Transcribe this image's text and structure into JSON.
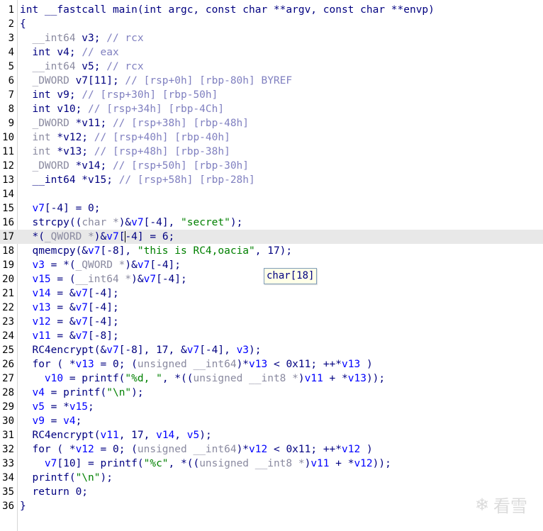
{
  "editor": {
    "current_line": 17,
    "lines": [
      {
        "n": "1",
        "parts": [
          [
            "kw",
            "int __fastcall main(int argc, const char **argv, const char **envp)"
          ]
        ]
      },
      {
        "n": "2",
        "parts": [
          [
            "kw",
            "{"
          ]
        ]
      },
      {
        "n": "3",
        "parts": [
          [
            "gr",
            "  __int64"
          ],
          [
            "kw",
            " v3; "
          ],
          [
            "cm",
            "// rcx"
          ]
        ]
      },
      {
        "n": "4",
        "parts": [
          [
            "kw",
            "  int v4; "
          ],
          [
            "cm",
            "// eax"
          ]
        ]
      },
      {
        "n": "5",
        "parts": [
          [
            "gr",
            "  __int64"
          ],
          [
            "kw",
            " v5; "
          ],
          [
            "cm",
            "// rcx"
          ]
        ]
      },
      {
        "n": "6",
        "parts": [
          [
            "gr",
            "  _DWORD"
          ],
          [
            "kw",
            " v7[11]; "
          ],
          [
            "cm",
            "// [rsp+0h] [rbp-80h] BYREF"
          ]
        ]
      },
      {
        "n": "7",
        "parts": [
          [
            "kw",
            "  int v9; "
          ],
          [
            "cm",
            "// [rsp+30h] [rbp-50h]"
          ]
        ]
      },
      {
        "n": "8",
        "parts": [
          [
            "kw",
            "  int v10; "
          ],
          [
            "cm",
            "// [rsp+34h] [rbp-4Ch]"
          ]
        ]
      },
      {
        "n": "9",
        "parts": [
          [
            "gr",
            "  _DWORD"
          ],
          [
            "kw",
            " *v11; "
          ],
          [
            "cm",
            "// [rsp+38h] [rbp-48h]"
          ]
        ]
      },
      {
        "n": "10",
        "parts": [
          [
            "gr",
            "  int"
          ],
          [
            "kw",
            " *v12; "
          ],
          [
            "cm",
            "// [rsp+40h] [rbp-40h]"
          ]
        ]
      },
      {
        "n": "11",
        "parts": [
          [
            "gr",
            "  int"
          ],
          [
            "kw",
            " *v13; "
          ],
          [
            "cm",
            "// [rsp+48h] [rbp-38h]"
          ]
        ]
      },
      {
        "n": "12",
        "parts": [
          [
            "gr",
            "  _DWORD"
          ],
          [
            "kw",
            " *v14; "
          ],
          [
            "cm",
            "// [rsp+50h] [rbp-30h]"
          ]
        ]
      },
      {
        "n": "13",
        "parts": [
          [
            "kw",
            "  __int64 *v15; "
          ],
          [
            "cm",
            "// [rsp+58h] [rbp-28h]"
          ]
        ]
      },
      {
        "n": "14",
        "parts": [
          [
            "kw",
            ""
          ]
        ]
      },
      {
        "n": "15",
        "parts": [
          [
            "vr",
            "  v7"
          ],
          [
            "kw",
            "[-4] = 0;"
          ]
        ]
      },
      {
        "n": "16",
        "parts": [
          [
            "kw",
            "  strcpy(("
          ],
          [
            "gr",
            "char *"
          ],
          [
            "kw",
            ")&"
          ],
          [
            "vr",
            "v7"
          ],
          [
            "kw",
            "[-4], "
          ],
          [
            "str",
            "\"secret\""
          ],
          [
            "kw",
            ");"
          ]
        ]
      },
      {
        "n": "17",
        "parts": [
          [
            "kw",
            "  *("
          ],
          [
            "gr",
            "_QWORD *"
          ],
          [
            "kw",
            ")&"
          ],
          [
            "vr",
            "v7"
          ],
          [
            "kw",
            "["
          ],
          [
            "cursor",
            ""
          ],
          [
            "kw",
            "-4] = 6;"
          ]
        ]
      },
      {
        "n": "18",
        "parts": [
          [
            "kw",
            "  qmemcpy(&"
          ],
          [
            "vr",
            "v7"
          ],
          [
            "kw",
            "[-8], "
          ],
          [
            "str",
            "\"this is RC4,oacia\""
          ],
          [
            "kw",
            ", 17);"
          ]
        ]
      },
      {
        "n": "19",
        "parts": [
          [
            "vr",
            "  v3"
          ],
          [
            "kw",
            " = *("
          ],
          [
            "gr",
            "_QWORD *"
          ],
          [
            "kw",
            ")&"
          ],
          [
            "vr",
            "v7"
          ],
          [
            "kw",
            "[-4];"
          ]
        ]
      },
      {
        "n": "20",
        "parts": [
          [
            "vr",
            "  v15"
          ],
          [
            "kw",
            " = ("
          ],
          [
            "gr",
            "__int64 *"
          ],
          [
            "kw",
            ")&"
          ],
          [
            "vr",
            "v7"
          ],
          [
            "kw",
            "[-4];"
          ]
        ]
      },
      {
        "n": "21",
        "parts": [
          [
            "vr",
            "  v14"
          ],
          [
            "kw",
            " = &"
          ],
          [
            "vr",
            "v7"
          ],
          [
            "kw",
            "[-4];"
          ]
        ]
      },
      {
        "n": "22",
        "parts": [
          [
            "vr",
            "  v13"
          ],
          [
            "kw",
            " = &"
          ],
          [
            "vr",
            "v7"
          ],
          [
            "kw",
            "[-4];"
          ]
        ]
      },
      {
        "n": "23",
        "parts": [
          [
            "vr",
            "  v12"
          ],
          [
            "kw",
            " = &"
          ],
          [
            "vr",
            "v7"
          ],
          [
            "kw",
            "[-4];"
          ]
        ]
      },
      {
        "n": "24",
        "parts": [
          [
            "vr",
            "  v11"
          ],
          [
            "kw",
            " = &"
          ],
          [
            "vr",
            "v7"
          ],
          [
            "kw",
            "[-8];"
          ]
        ]
      },
      {
        "n": "25",
        "parts": [
          [
            "kw",
            "  RC4encrypt(&"
          ],
          [
            "vr",
            "v7"
          ],
          [
            "kw",
            "[-8], 17, &"
          ],
          [
            "vr",
            "v7"
          ],
          [
            "kw",
            "[-4], "
          ],
          [
            "vr",
            "v3"
          ],
          [
            "kw",
            ");"
          ]
        ]
      },
      {
        "n": "26",
        "parts": [
          [
            "kw",
            "  for ( *"
          ],
          [
            "vr",
            "v13"
          ],
          [
            "kw",
            " = 0; ("
          ],
          [
            "gr",
            "unsigned __int64"
          ],
          [
            "kw",
            ")*"
          ],
          [
            "vr",
            "v13"
          ],
          [
            "kw",
            " < 0x11; ++*"
          ],
          [
            "vr",
            "v13"
          ],
          [
            "kw",
            " )"
          ]
        ]
      },
      {
        "n": "27",
        "parts": [
          [
            "vr",
            "    v10"
          ],
          [
            "kw",
            " = printf("
          ],
          [
            "str",
            "\"%d, \""
          ],
          [
            "kw",
            ", *(("
          ],
          [
            "gr",
            "unsigned __int8 *"
          ],
          [
            "kw",
            ")"
          ],
          [
            "vr",
            "v11"
          ],
          [
            "kw",
            " + *"
          ],
          [
            "vr",
            "v13"
          ],
          [
            "kw",
            "));"
          ]
        ]
      },
      {
        "n": "28",
        "parts": [
          [
            "vr",
            "  v4"
          ],
          [
            "kw",
            " = printf("
          ],
          [
            "str",
            "\"\\n\""
          ],
          [
            "kw",
            ");"
          ]
        ]
      },
      {
        "n": "29",
        "parts": [
          [
            "vr",
            "  v5"
          ],
          [
            "kw",
            " = *"
          ],
          [
            "vr",
            "v15"
          ],
          [
            "kw",
            ";"
          ]
        ]
      },
      {
        "n": "30",
        "parts": [
          [
            "vr",
            "  v9"
          ],
          [
            "kw",
            " = "
          ],
          [
            "vr",
            "v4"
          ],
          [
            "kw",
            ";"
          ]
        ]
      },
      {
        "n": "31",
        "parts": [
          [
            "kw",
            "  RC4encrypt("
          ],
          [
            "vr",
            "v11"
          ],
          [
            "kw",
            ", 17, "
          ],
          [
            "vr",
            "v14"
          ],
          [
            "kw",
            ", "
          ],
          [
            "vr",
            "v5"
          ],
          [
            "kw",
            ");"
          ]
        ]
      },
      {
        "n": "32",
        "parts": [
          [
            "kw",
            "  for ( *"
          ],
          [
            "vr",
            "v12"
          ],
          [
            "kw",
            " = 0; ("
          ],
          [
            "gr",
            "unsigned __int64"
          ],
          [
            "kw",
            ")*"
          ],
          [
            "vr",
            "v12"
          ],
          [
            "kw",
            " < 0x11; ++*"
          ],
          [
            "vr",
            "v12"
          ],
          [
            "kw",
            " )"
          ]
        ]
      },
      {
        "n": "33",
        "parts": [
          [
            "vr",
            "    v7"
          ],
          [
            "kw",
            "[10] = printf("
          ],
          [
            "str",
            "\"%c\""
          ],
          [
            "kw",
            ", *(("
          ],
          [
            "gr",
            "unsigned __int8 *"
          ],
          [
            "kw",
            ")"
          ],
          [
            "vr",
            "v11"
          ],
          [
            "kw",
            " + *"
          ],
          [
            "vr",
            "v12"
          ],
          [
            "kw",
            "));"
          ]
        ]
      },
      {
        "n": "34",
        "parts": [
          [
            "kw",
            "  printf("
          ],
          [
            "str",
            "\"\\n\""
          ],
          [
            "kw",
            ");"
          ]
        ]
      },
      {
        "n": "35",
        "parts": [
          [
            "kw",
            "  return 0;"
          ]
        ]
      },
      {
        "n": "36",
        "parts": [
          [
            "kw",
            "}"
          ]
        ]
      }
    ]
  },
  "tooltip": {
    "text": "char[18]"
  },
  "watermark": {
    "icon": "snowflake-icon",
    "text": "看雪"
  }
}
